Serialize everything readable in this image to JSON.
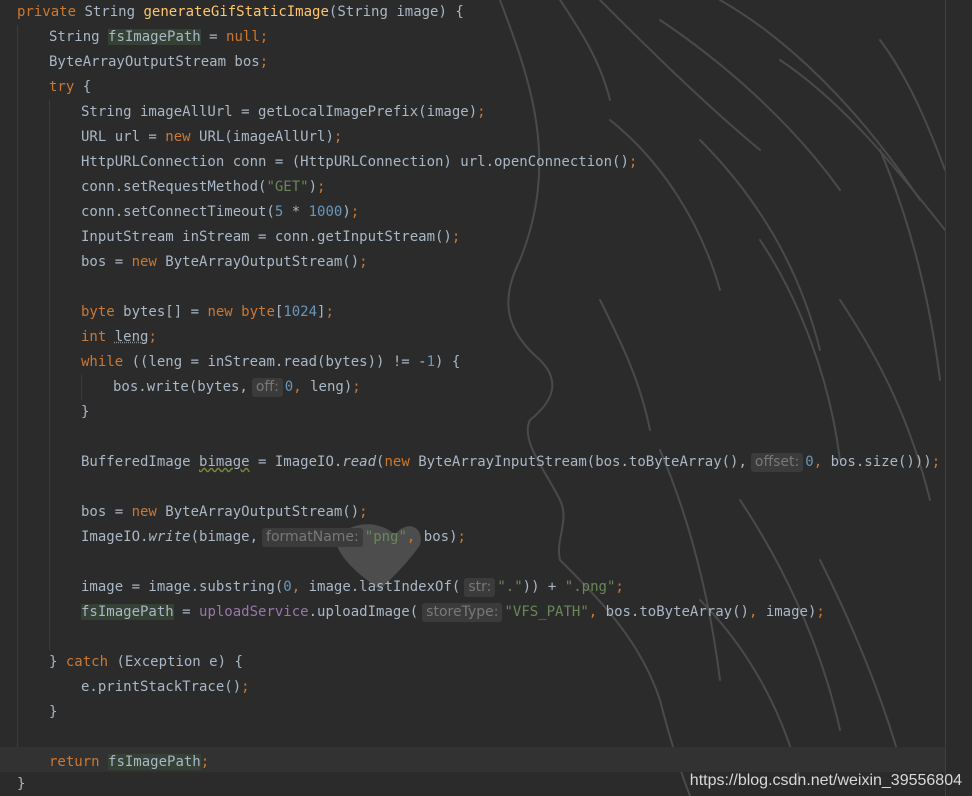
{
  "editor": {
    "theme_colors": {
      "background": "#2b2b2b",
      "keyword": "#cc7832",
      "method_declaration": "#ffc66d",
      "string": "#6a8759",
      "number": "#6897bb",
      "field": "#9876aa",
      "default_text": "#a9b7c6"
    },
    "code": {
      "l1_private": "private",
      "l1_string": "String",
      "l1_method": "generateGifStaticImage",
      "l1_params": "(String image) {",
      "l2_type": "String",
      "l2_var": "fsImagePath",
      "l2_eq": " = ",
      "l2_null": "null",
      "l3_decl": "ByteArrayOutputStream bos",
      "l4_try": "try",
      "l4_brace": " {",
      "l5_text": "String imageAllUrl = getLocalImagePrefix(image)",
      "l6_a": "URL url = ",
      "l6_new": "new",
      "l6_b": " URL(imageAllUrl)",
      "l7_text": "HttpURLConnection conn = (HttpURLConnection) url.openConnection()",
      "l8_a": "conn.setRequestMethod(",
      "l8_str": "\"GET\"",
      "l8_b": ")",
      "l9_a": "conn.setConnectTimeout(",
      "l9_num1": "5",
      "l9_op": " * ",
      "l9_num2": "1000",
      "l9_b": ")",
      "l10_text": "InputStream inStream = conn.getInputStream()",
      "l11_a": "bos = ",
      "l11_new": "new",
      "l11_b": " ByteArrayOutputStream()",
      "l13_byte": "byte",
      "l13_a": " bytes[] = ",
      "l13_new": "new",
      "l13_byte2": "byte",
      "l13_b": "[",
      "l13_num": "1024",
      "l13_c": "]",
      "l14_int": "int",
      "l14_var": "leng",
      "l15_while": "while",
      "l15_a": " ((leng = inStream.read(bytes)) != -",
      "l15_num": "1",
      "l15_b": ") {",
      "l16_a": "bos.write(bytes,",
      "l16_hint": "off:",
      "l16_num": "0",
      "l16_b": "leng)",
      "l17_close": "}",
      "l19_a": "BufferedImage ",
      "l19_var": "bimage",
      "l19_b": " = ImageIO.",
      "l19_read": "read",
      "l19_c": "(",
      "l19_new": "new",
      "l19_d": " ByteArrayInputStream(bos.toByteArray(),",
      "l19_hint": "offset:",
      "l19_num": "0",
      "l19_e": "bos.size()))",
      "l21_a": "bos = ",
      "l21_new": "new",
      "l21_b": " ByteArrayOutputStream()",
      "l22_a": "ImageIO.",
      "l22_write": "write",
      "l22_b": "(bimage,",
      "l22_hint": "formatName:",
      "l22_str": "\"png\"",
      "l22_c": "bos)",
      "l24_a": "image = image.substring(",
      "l24_num": "0",
      "l24_b": "image.lastIndexOf(",
      "l24_hint": "str:",
      "l24_str": "\".\"",
      "l24_c": ")) + ",
      "l24_str2": "\".png\"",
      "l25_var": "fsImagePath",
      "l25_a": " = ",
      "l25_field": "uploadService",
      "l25_b": ".uploadImage(",
      "l25_hint": "storeType:",
      "l25_str": "\"VFS_PATH\"",
      "l25_c": "bos.toByteArray()",
      "l25_d": "image)",
      "l27_open": "} ",
      "l27_catch": "catch",
      "l27_b": " (Exception e) {",
      "l28_text": "e.printStackTrace()",
      "l29_close": "}",
      "l31_return": "return",
      "l31_var": "fsImagePath",
      "l32_close": "}",
      "semicolon": ";",
      "comma": ","
    }
  },
  "watermark": "https://blog.csdn.net/weixin_39556804"
}
